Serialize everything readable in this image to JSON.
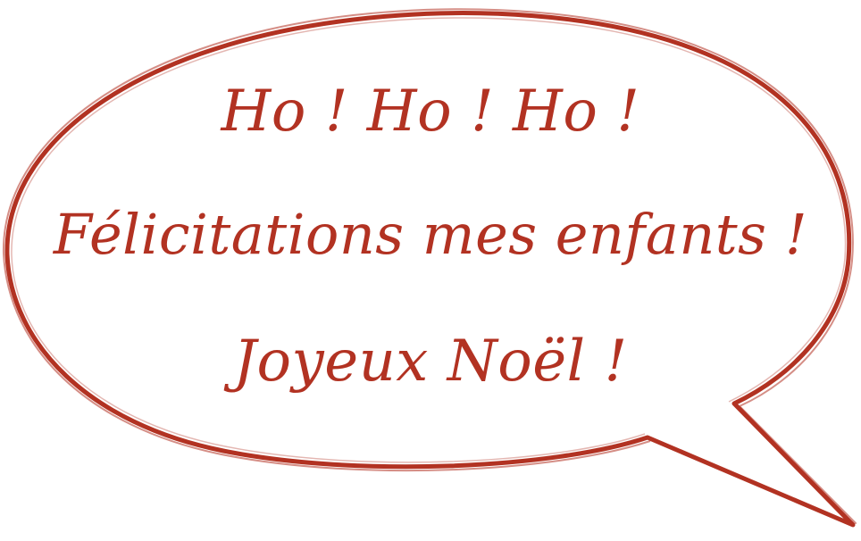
{
  "theme": {
    "ink_color": "#b23222",
    "background": "#ffffff"
  },
  "speech_bubble": {
    "lines": [
      "Ho ! Ho ! Ho !",
      "Félicitations mes enfants !",
      "Joyeux Noël !"
    ]
  }
}
